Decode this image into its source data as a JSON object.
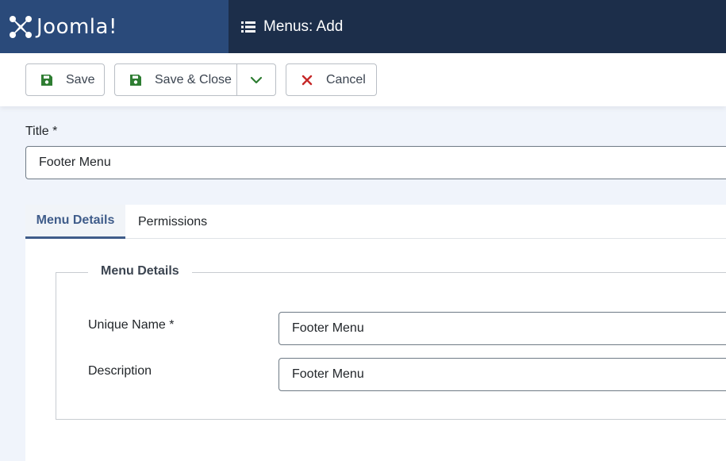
{
  "header": {
    "brand": "Joomla!",
    "title": "Menus: Add"
  },
  "toolbar": {
    "save_label": "Save",
    "save_close_label": "Save & Close",
    "cancel_label": "Cancel"
  },
  "form": {
    "title_label": "Title *",
    "title_value": "Footer Menu"
  },
  "tabs": [
    {
      "label": "Menu Details",
      "active": true
    },
    {
      "label": "Permissions",
      "active": false
    }
  ],
  "details": {
    "legend": "Menu Details",
    "fields": [
      {
        "label": "Unique Name *",
        "value": "Footer Menu"
      },
      {
        "label": "Description",
        "value": "Footer Menu"
      }
    ]
  },
  "colors": {
    "header_bg": "#1c2e4a",
    "brand_bg": "#2a4a7a",
    "save_icon": "#2e7d32",
    "cancel_icon": "#c62828",
    "active_tab": "#3f5c8a"
  },
  "icons": {
    "brand": "joomla-logo-icon",
    "title": "list-icon",
    "save": "save-icon",
    "dropdown": "chevron-down-icon",
    "cancel": "close-icon"
  }
}
